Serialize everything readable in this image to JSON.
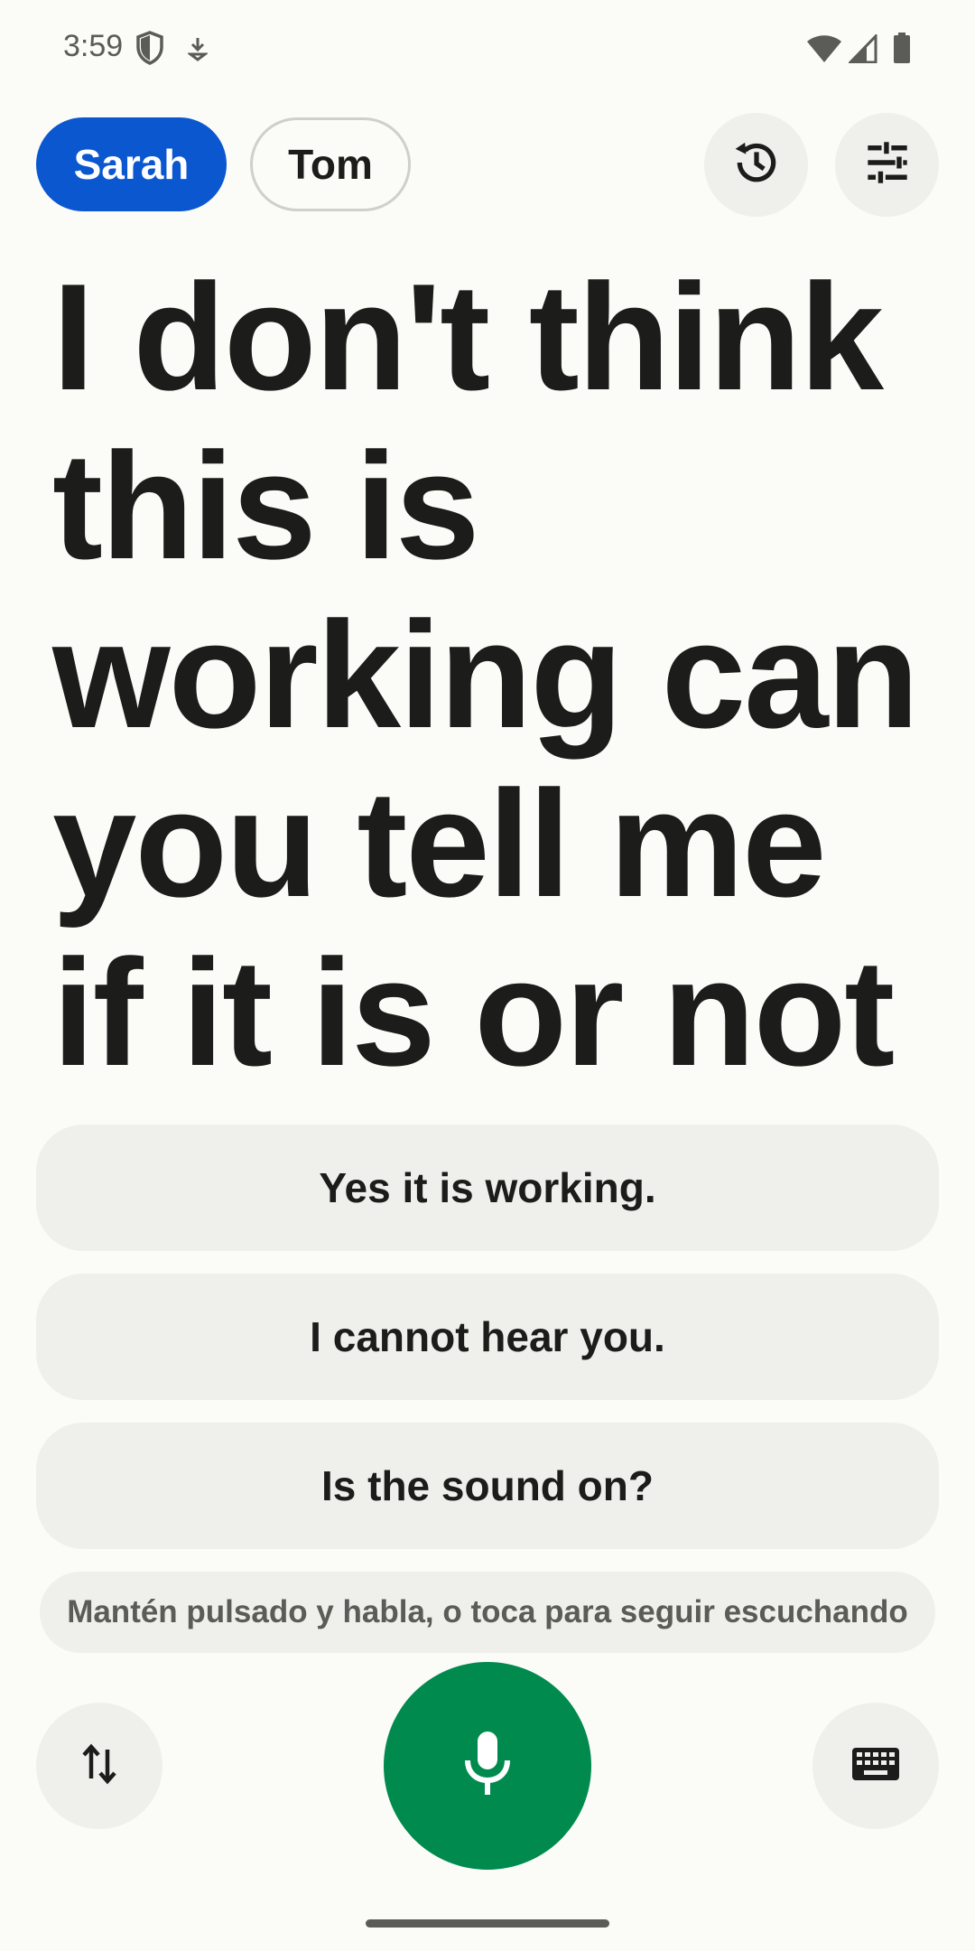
{
  "status_bar": {
    "time": "3:59",
    "icons": [
      "shield-icon",
      "download-icon",
      "wifi-icon",
      "cellular-signal-icon",
      "battery-icon"
    ]
  },
  "speakers": {
    "active": "Sarah",
    "inactive": "Tom"
  },
  "toolbar": {
    "history_icon": "history-icon",
    "settings_icon": "tune-icon"
  },
  "transcript": {
    "text": "I don't think this is working can you tell me if it is or not"
  },
  "suggested_replies": [
    {
      "label": "Yes it is working."
    },
    {
      "label": "I cannot hear you."
    },
    {
      "label": "Is the sound on?"
    }
  ],
  "hint": {
    "text": "Mantén pulsado y habla, o toca para seguir escuchando"
  },
  "bottom_bar": {
    "swap_icon": "swap-vertical-icon",
    "mic_icon": "microphone-icon",
    "keyboard_icon": "keyboard-icon"
  },
  "colors": {
    "accent": "#0b57d0",
    "mic": "#008a4d",
    "surface": "#efefec",
    "background": "#fbfbf8"
  }
}
